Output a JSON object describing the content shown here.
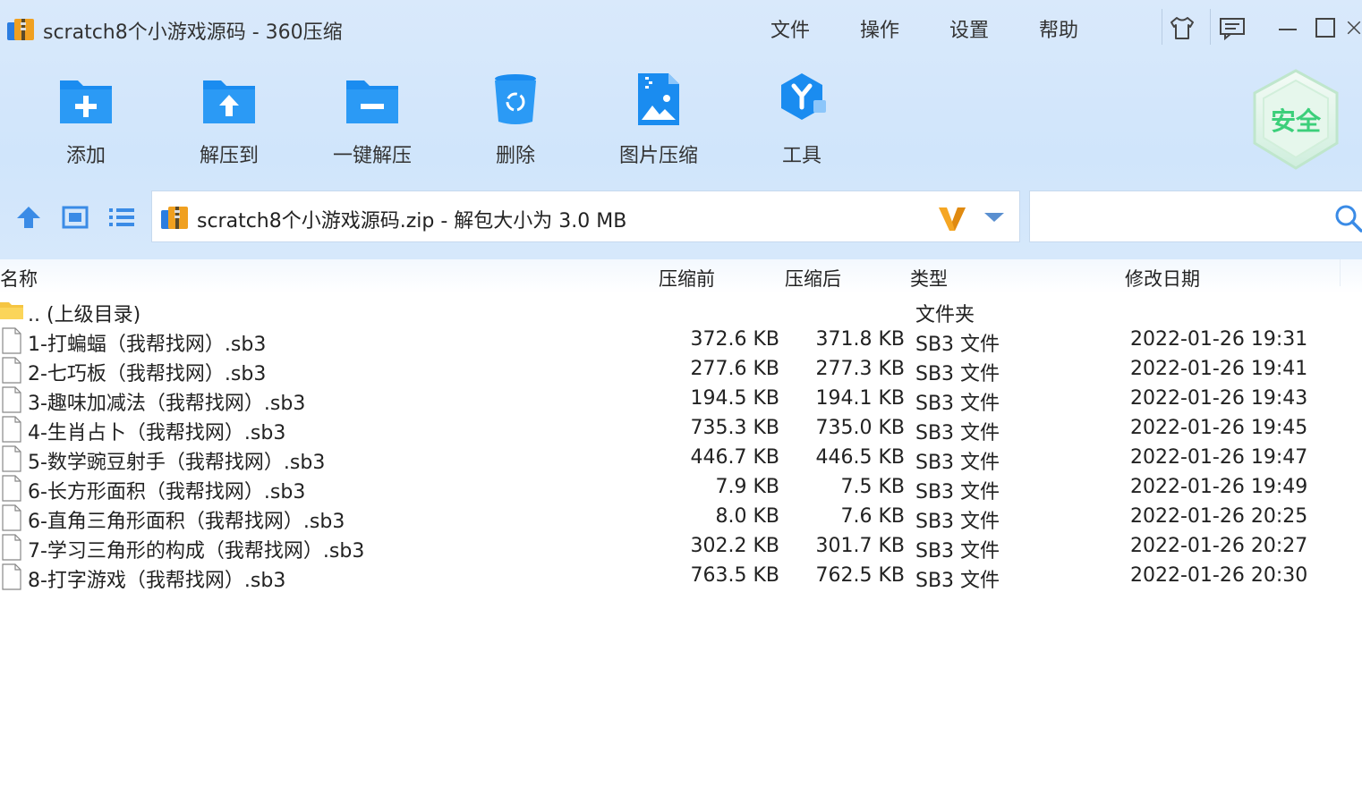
{
  "window": {
    "title": "scratch8个小游戏源码 - 360压缩",
    "menu": [
      "文件",
      "操作",
      "设置",
      "帮助"
    ],
    "controls": [
      "skin-icon",
      "feedback-icon",
      "minimize-icon",
      "maximize-icon",
      "close-icon"
    ]
  },
  "toolbar": {
    "items": [
      {
        "label": "添加",
        "icon": "add-folder-icon"
      },
      {
        "label": "解压到",
        "icon": "extract-to-icon"
      },
      {
        "label": "一键解压",
        "icon": "one-click-extract-icon"
      },
      {
        "label": "删除",
        "icon": "trash-icon"
      },
      {
        "label": "图片压缩",
        "icon": "image-compress-icon"
      },
      {
        "label": "工具",
        "icon": "tools-icon"
      }
    ],
    "security_badge": "安全"
  },
  "address": {
    "text": "scratch8个小游戏源码.zip - 解包大小为 3.0 MB",
    "search_placeholder": ""
  },
  "columns": {
    "name": "名称",
    "before": "压缩前",
    "after": "压缩后",
    "type": "类型",
    "date": "修改日期"
  },
  "parent": {
    "name": ".. (上级目录)",
    "type": "文件夹"
  },
  "files": [
    {
      "name": "1-打蝙蝠（我帮找网）.sb3",
      "before": "372.6 KB",
      "after": "371.8 KB",
      "type": "SB3 文件",
      "date": "2022-01-26 19:31"
    },
    {
      "name": "2-七巧板（我帮找网）.sb3",
      "before": "277.6 KB",
      "after": "277.3 KB",
      "type": "SB3 文件",
      "date": "2022-01-26 19:41"
    },
    {
      "name": "3-趣味加减法（我帮找网）.sb3",
      "before": "194.5 KB",
      "after": "194.1 KB",
      "type": "SB3 文件",
      "date": "2022-01-26 19:43"
    },
    {
      "name": "4-生肖占卜（我帮找网）.sb3",
      "before": "735.3 KB",
      "after": "735.0 KB",
      "type": "SB3 文件",
      "date": "2022-01-26 19:45"
    },
    {
      "name": "5-数学豌豆射手（我帮找网）.sb3",
      "before": "446.7 KB",
      "after": "446.5 KB",
      "type": "SB3 文件",
      "date": "2022-01-26 19:47"
    },
    {
      "name": "6-长方形面积（我帮找网）.sb3",
      "before": "7.9 KB",
      "after": "7.5 KB",
      "type": "SB3 文件",
      "date": "2022-01-26 19:49"
    },
    {
      "name": "6-直角三角形面积（我帮找网）.sb3",
      "before": "8.0 KB",
      "after": "7.6 KB",
      "type": "SB3 文件",
      "date": "2022-01-26 20:25"
    },
    {
      "name": "7-学习三角形的构成（我帮找网）.sb3",
      "before": "302.2 KB",
      "after": "301.7 KB",
      "type": "SB3 文件",
      "date": "2022-01-26 20:27"
    },
    {
      "name": "8-打字游戏（我帮找网）.sb3",
      "before": "763.5 KB",
      "after": "762.5 KB",
      "type": "SB3 文件",
      "date": "2022-01-26 20:30"
    }
  ],
  "colors": {
    "accent": "#1a8cf0",
    "toolbar_bg": "#d3e6fb",
    "badge_green": "#3ccf7a",
    "v_orange": "#f5a623"
  }
}
